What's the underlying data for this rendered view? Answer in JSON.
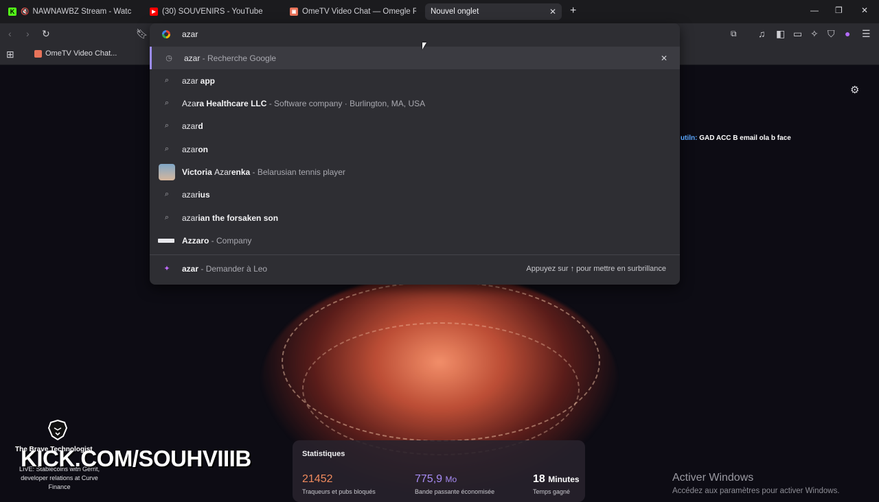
{
  "tabs": [
    {
      "label": "NAWNAWBZ Stream - Watch Live",
      "icon": "kick-icon"
    },
    {
      "label": "(30) SOUVENIRS - YouTube",
      "icon": "youtube-icon"
    },
    {
      "label": "OmeTV Video Chat — Omegle Random",
      "icon": "ometv-icon"
    },
    {
      "label": "Nouvel onglet",
      "icon": ""
    }
  ],
  "bookmarks": [
    {
      "label": "OmeTV Video Chat..."
    }
  ],
  "omnibox": {
    "value": "azar",
    "suggestions": [
      {
        "icon": "history-icon",
        "query": "azar",
        "bold": "",
        "sub": " - Recherche Google"
      },
      {
        "icon": "search-icon",
        "query": "azar",
        "bold": " app",
        "sub": ""
      },
      {
        "icon": "search-icon",
        "query": "Aza",
        "bold": "ra Healthcare LLC",
        "sub": " - Software company · Burlington, MA, USA"
      },
      {
        "icon": "search-icon",
        "query": "azar",
        "bold": "d",
        "sub": ""
      },
      {
        "icon": "search-icon",
        "query": "azar",
        "bold": "on",
        "sub": ""
      },
      {
        "icon": "avatar-icon",
        "query": "",
        "bold": "Victoria ",
        "mid": "Azar",
        "bold2": "enka",
        "sub": " - Belarusian tennis player"
      },
      {
        "icon": "search-icon",
        "query": "azar",
        "bold": "ius",
        "sub": ""
      },
      {
        "icon": "search-icon",
        "query": "azar",
        "bold": "ian the forsaken son",
        "sub": ""
      },
      {
        "icon": "azzaro-logo-icon",
        "query": "",
        "bold": "Azzaro",
        "sub": " - Company"
      }
    ],
    "leo": {
      "query": "azar",
      "sub": " - Demander à Leo",
      "hint": "Appuyez sur ↑ pour mettre en surbrillance"
    }
  },
  "chat": {
    "user": "utiln:",
    "message": "GAD ACC B email ola b face"
  },
  "stats": {
    "title": "Statistiques",
    "items": [
      {
        "value": "21452",
        "unit": "",
        "label": "Traqueurs et pubs bloqués",
        "color": "#f08a5d"
      },
      {
        "value": "775,9",
        "unit": "Mo",
        "label": "Bande passante économisée",
        "color": "#a88cf5"
      },
      {
        "value": "18",
        "unit": "Minutes",
        "label": "Temps gagné",
        "color": "#ffffff"
      }
    ]
  },
  "overlay": {
    "kick": "KICK.COM/SOUHVIIIB",
    "brave_title": "The Brave Technologist",
    "brave_sub": "LIVE: Stablecoins with Gerrit, developer relations at Curve Finance"
  },
  "windows": {
    "activate": "Activer Windows",
    "activate_sub": "Accédez aux paramètres pour activer Windows."
  },
  "colors": {
    "accent": "#9c8cf0",
    "kick_green": "#53fc18"
  }
}
